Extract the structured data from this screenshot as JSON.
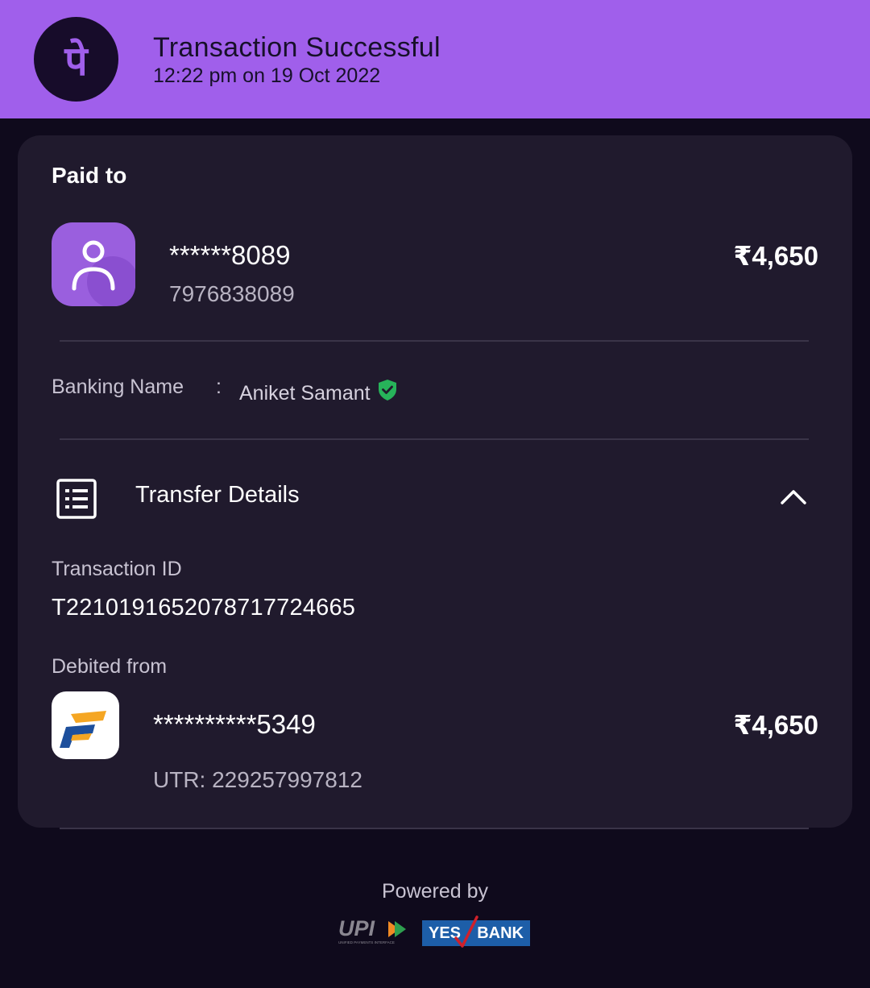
{
  "header": {
    "title": "Transaction Successful",
    "subtitle": "12:22 pm on 19 Oct 2022",
    "logo_glyph": "पे",
    "bg_color": "#a05feb"
  },
  "payee": {
    "section_label": "Paid to",
    "masked_number": "******8089",
    "phone": "7976838089",
    "amount": "₹4,650",
    "avatar_icon": "person-icon"
  },
  "banking": {
    "label": "Banking Name",
    "separator": ":",
    "name": "Aniket Samant",
    "verified_icon": "verified-shield-icon"
  },
  "transfer": {
    "title": "Transfer Details",
    "icon": "document-list-icon",
    "toggle_icon": "chevron-up-icon",
    "transaction_id_label": "Transaction ID",
    "transaction_id": "T2210191652078717724665",
    "debited_label": "Debited from",
    "account_masked": "**********5349",
    "amount": "₹4,650",
    "utr": "UTR: 229257997812"
  },
  "footer": {
    "powered_by": "Powered by",
    "upi_text": "UPI",
    "upi_tagline": "UNIFIED PAYMENTS INTERFACE",
    "bank_yes": "YES",
    "bank_word": "BANK"
  }
}
